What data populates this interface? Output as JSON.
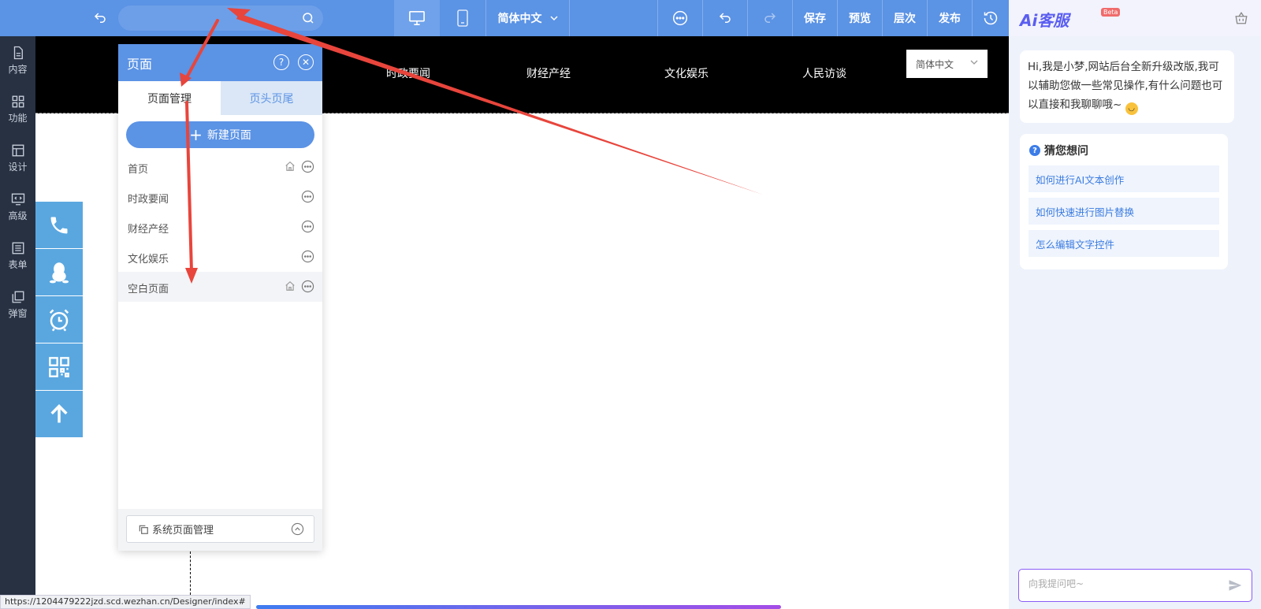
{
  "toolbar": {
    "undo_icon": "undo-icon",
    "search_placeholder": "",
    "language": "简体中文",
    "save_label": "保存",
    "preview_label": "预览",
    "layers_label": "层次",
    "publish_label": "发布"
  },
  "sidebar": {
    "items": [
      {
        "label": "内容",
        "icon": "file-icon"
      },
      {
        "label": "功能",
        "icon": "grid-icon"
      },
      {
        "label": "设计",
        "icon": "layout-icon"
      },
      {
        "label": "高级",
        "icon": "code-monitor-icon"
      },
      {
        "label": "表单",
        "icon": "form-icon"
      },
      {
        "label": "弹窗",
        "icon": "popup-icon"
      }
    ]
  },
  "site": {
    "nav": [
      "时政要闻",
      "财经产经",
      "文化娱乐",
      "人民访谈"
    ],
    "language": "简体中文"
  },
  "float_tools": [
    "phone-icon",
    "qq-penguin-icon",
    "alarm-clock-icon",
    "qr-code-icon",
    "arrow-up-icon"
  ],
  "page_panel": {
    "title": "页面",
    "tabs": [
      "页面管理",
      "页头页尾"
    ],
    "active_tab": 0,
    "new_page_label": "新建页面",
    "pages": [
      {
        "name": "首页",
        "home": true
      },
      {
        "name": "时政要闻",
        "home": false
      },
      {
        "name": "财经产经",
        "home": false
      },
      {
        "name": "文化娱乐",
        "home": false
      },
      {
        "name": "空白页面",
        "home": true
      }
    ],
    "system_pages_label": "系统页面管理"
  },
  "ai": {
    "logo_text": "Ai客服",
    "beta": "Beta",
    "greeting": "Hi,我是小梦,网站后台全新升级改版,我可以辅助您做一些常见操作,有什么问题也可以直接和我聊聊哦~",
    "guess_title": "猜您想问",
    "questions": [
      "如何进行AI文本创作",
      "如何快速进行图片替换",
      "怎么编辑文字控件"
    ],
    "input_placeholder": "向我提问吧~"
  },
  "status_url": "https://1204479222jzd.scd.wezhan.cn/Designer/index#",
  "colors": {
    "toolbar": "#5b93e5",
    "sidebar": "#273142",
    "accent": "#5b93e5",
    "arrow": "#e8453c",
    "ai_accent": "#8b5cf6"
  }
}
